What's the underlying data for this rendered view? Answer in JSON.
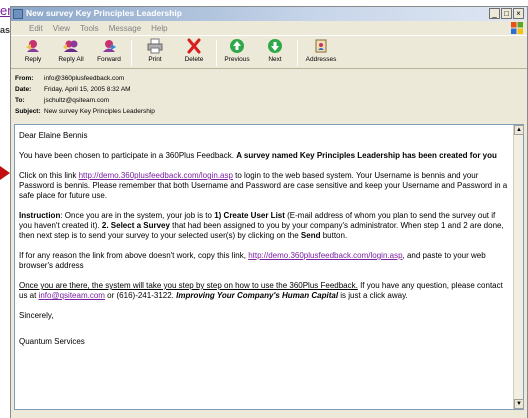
{
  "background": {
    "link_fragment": "em",
    "text_fragment": "ased"
  },
  "window": {
    "title": "New survey Key Principles Leadership",
    "controls": {
      "minimize": "_",
      "maximize": "□",
      "close": "×"
    }
  },
  "menu": [
    "File",
    "Edit",
    "View",
    "Tools",
    "Message",
    "Help"
  ],
  "toolbar": {
    "reply": "Reply",
    "reply_all": "Reply All",
    "forward": "Forward",
    "print": "Print",
    "delete": "Delete",
    "previous": "Previous",
    "next": "Next",
    "addresses": "Addresses"
  },
  "headers": {
    "from_label": "From:",
    "from": "info@360plusfeedback.com",
    "date_label": "Date:",
    "date": "Friday, April 15, 2005 8:32 AM",
    "to_label": "To:",
    "to": "jschultz@qsiteam.com",
    "subject_label": "Subject:",
    "subject": "New survey Key Principles Leadership"
  },
  "message": {
    "greeting": "Dear Elaine Bennis",
    "p1_a": "You have been chosen to participate in a 360Plus Feedback. ",
    "p1_b": "A survey named Key Principles Leadership has been created for you",
    "p2_a": "Click on this link ",
    "p2_link": "http://demo.360plusfeedback.com/login.asp",
    "p2_b": " to login to the web based system. Your Username is bennis and your Password is bennis. Please remember that both Username and Password are case sensitive and keep your Username and Password in a safe place for future use.",
    "p3_label": "Instruction",
    "p3_a": ": Once you are in the system, your job is to ",
    "p3_b": "1) Create User List",
    "p3_c": " (E-mail address of whom you plan to send the survey out if you haven't created it). ",
    "p3_d": "2. Select a Survey",
    "p3_e": " that had been assigned to you by your company's administrator. When step 1 and 2 are done, then next step is to send your survey to your selected user(s) by clicking on the ",
    "p3_f": "Send",
    "p3_g": " button.",
    "p4_a": "If for any reason the link from above doesn't work, copy this link, ",
    "p4_link": "http://demo.360plusfeedback.com/login.asp",
    "p4_b": ", and paste to your web browser's address",
    "p5_a": "Once you are there, the system will take you step by step on how to use the 360Plus Feedback.",
    "p5_b": " If you have any question, please contact us at ",
    "p5_link": "info@qsiteam.com",
    "p5_c": " or (616)-241-3122. ",
    "p5_d": "Improving Your Company's Human Capital",
    "p5_e": " is just a click away.",
    "closing": "Sincerely,",
    "signature": "Quantum Services"
  },
  "colors": {
    "link": "#7a1fa0",
    "titlebar": "#8aa6c8",
    "window_bg": "#ece9d8",
    "arrow": "#c01010"
  }
}
